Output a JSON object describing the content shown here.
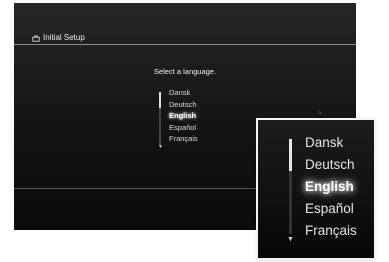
{
  "header": {
    "title": "Initial Setup",
    "icon": "toolbox-icon"
  },
  "main": {
    "prompt": "Select a language.",
    "languages": [
      "Dansk",
      "Deutsch",
      "English",
      "Español",
      "Français"
    ],
    "selected": "English"
  },
  "zoom": {
    "languages": [
      "Dansk",
      "Deutsch",
      "English",
      "Español",
      "Français"
    ],
    "selected": "English"
  }
}
